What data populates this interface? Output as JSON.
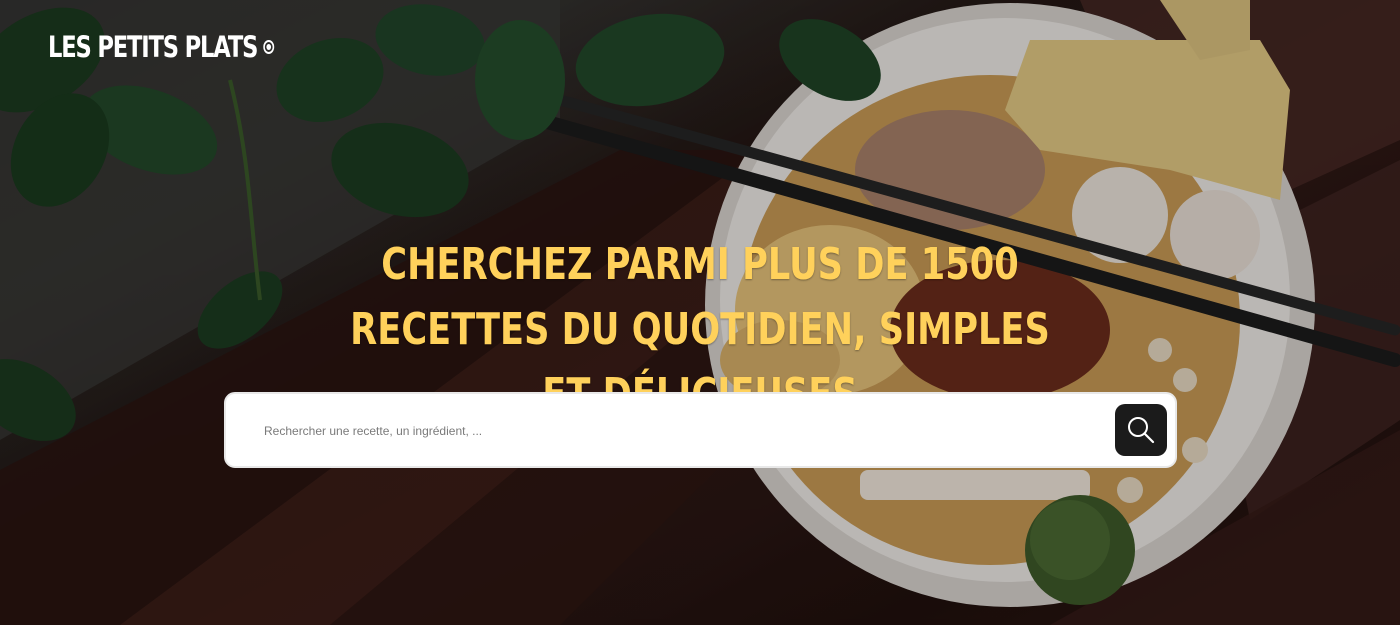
{
  "header": {
    "logo_text": "LES PETITS PLATS"
  },
  "hero": {
    "headline": "CHERCHEZ PARMI PLUS DE 1500 RECETTES DU QUOTIDIEN, SIMPLES ET DÉLICIEUSES"
  },
  "search": {
    "placeholder": "Rechercher une recette, un ingrédient, ...",
    "value": "",
    "button_icon": "search-icon"
  },
  "colors": {
    "accent": "#FFD15B",
    "search_button": "#1B1B1B",
    "logo": "#FFFFFF"
  }
}
